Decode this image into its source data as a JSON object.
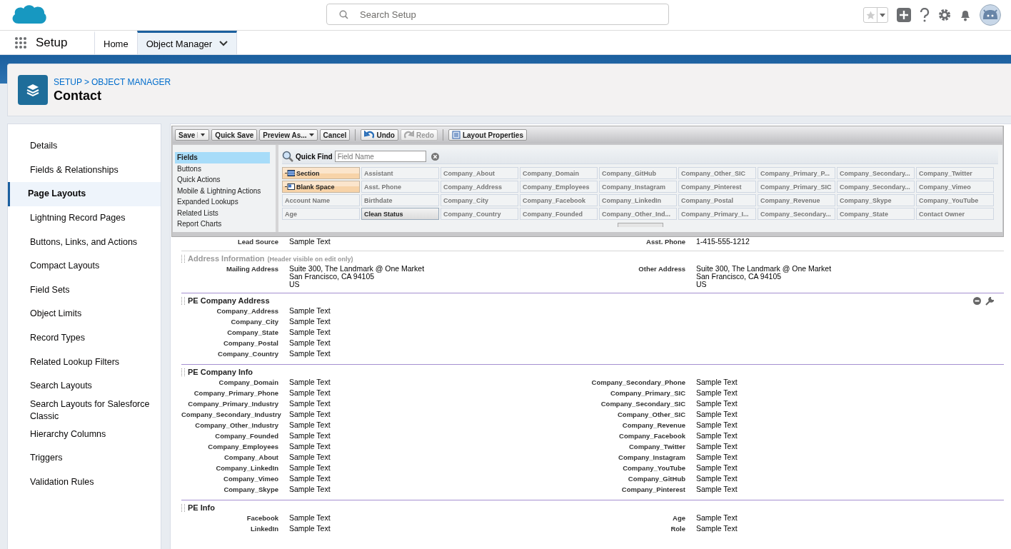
{
  "header": {
    "search": {
      "placeholder": "Search Setup"
    }
  },
  "nav": {
    "app_name": "Setup",
    "tabs": [
      {
        "label": "Home",
        "selected": false,
        "dropdown": false
      },
      {
        "label": "Object Manager",
        "selected": true,
        "dropdown": true
      }
    ]
  },
  "page_header": {
    "breadcrumb": [
      "SETUP",
      "OBJECT MANAGER"
    ],
    "separator": ">",
    "title": "Contact"
  },
  "sidebar": {
    "items": [
      {
        "label": "Details",
        "selected": false
      },
      {
        "label": "Fields & Relationships",
        "selected": false
      },
      {
        "label": "Page Layouts",
        "selected": true
      },
      {
        "label": "Lightning Record Pages",
        "selected": false
      },
      {
        "label": "Buttons, Links, and Actions",
        "selected": false
      },
      {
        "label": "Compact Layouts",
        "selected": false
      },
      {
        "label": "Field Sets",
        "selected": false
      },
      {
        "label": "Object Limits",
        "selected": false
      },
      {
        "label": "Record Types",
        "selected": false
      },
      {
        "label": "Related Lookup Filters",
        "selected": false
      },
      {
        "label": "Search Layouts",
        "selected": false
      },
      {
        "label": "Search Layouts for Salesforce Classic",
        "selected": false
      },
      {
        "label": "Hierarchy Columns",
        "selected": false
      },
      {
        "label": "Triggers",
        "selected": false
      },
      {
        "label": "Validation Rules",
        "selected": false
      }
    ]
  },
  "toolbar": {
    "groups": [
      [
        {
          "label": "Save",
          "kind": "split",
          "disabled": false
        },
        {
          "label": "Quick Save",
          "kind": "plain",
          "disabled": false
        },
        {
          "label": "Preview As...",
          "kind": "menu",
          "disabled": false
        },
        {
          "label": "Cancel",
          "kind": "plain",
          "disabled": false
        }
      ],
      [
        {
          "label": "Undo",
          "kind": "undo",
          "disabled": false
        },
        {
          "label": "Redo",
          "kind": "redo",
          "disabled": true
        }
      ],
      [
        {
          "label": "Layout Properties",
          "kind": "properties",
          "disabled": false
        }
      ]
    ]
  },
  "palette": {
    "categories": [
      {
        "label": "Fields",
        "selected": true
      },
      {
        "label": "Buttons",
        "selected": false
      },
      {
        "label": "Quick Actions",
        "selected": false
      },
      {
        "label": "Mobile & Lightning Actions",
        "selected": false
      },
      {
        "label": "Expanded Lookups",
        "selected": false
      },
      {
        "label": "Related Lists",
        "selected": false
      },
      {
        "label": "Report Charts",
        "selected": false
      }
    ],
    "quick_find": {
      "label": "Quick Find",
      "placeholder": "Field Name"
    },
    "items": [
      {
        "label": "Section",
        "kind": "section",
        "selected": false
      },
      {
        "label": "Assistant",
        "kind": "field",
        "selected": false
      },
      {
        "label": "Company_About",
        "kind": "field",
        "selected": false
      },
      {
        "label": "Company_Domain",
        "kind": "field",
        "selected": false
      },
      {
        "label": "Company_GitHub",
        "kind": "field",
        "selected": false
      },
      {
        "label": "Company_Other_SIC",
        "kind": "field",
        "selected": false
      },
      {
        "label": "Company_Primary_P...",
        "kind": "field",
        "selected": false
      },
      {
        "label": "Company_Secondary...",
        "kind": "field",
        "selected": false
      },
      {
        "label": "Company_Twitter",
        "kind": "field",
        "selected": false
      },
      {
        "label": "Blank Space",
        "kind": "blank",
        "selected": false
      },
      {
        "label": "Asst. Phone",
        "kind": "field",
        "selected": false
      },
      {
        "label": "Company_Address",
        "kind": "field",
        "selected": false
      },
      {
        "label": "Company_Employees",
        "kind": "field",
        "selected": false
      },
      {
        "label": "Company_Instagram",
        "kind": "field",
        "selected": false
      },
      {
        "label": "Company_Pinterest",
        "kind": "field",
        "selected": false
      },
      {
        "label": "Company_Primary_SIC",
        "kind": "field",
        "selected": false
      },
      {
        "label": "Company_Secondary...",
        "kind": "field",
        "selected": false
      },
      {
        "label": "Company_Vimeo",
        "kind": "field",
        "selected": false
      },
      {
        "label": "Account Name",
        "kind": "field",
        "selected": false
      },
      {
        "label": "Birthdate",
        "kind": "field",
        "selected": false
      },
      {
        "label": "Company_City",
        "kind": "field",
        "selected": false
      },
      {
        "label": "Company_Facebook",
        "kind": "field",
        "selected": false
      },
      {
        "label": "Company_LinkedIn",
        "kind": "field",
        "selected": false
      },
      {
        "label": "Company_Postal",
        "kind": "field",
        "selected": false
      },
      {
        "label": "Company_Revenue",
        "kind": "field",
        "selected": false
      },
      {
        "label": "Company_Skype",
        "kind": "field",
        "selected": false
      },
      {
        "label": "Company_YouTube",
        "kind": "field",
        "selected": false
      },
      {
        "label": "Age",
        "kind": "field",
        "selected": false
      },
      {
        "label": "Clean Status",
        "kind": "field",
        "selected": true
      },
      {
        "label": "Company_Country",
        "kind": "field",
        "selected": false
      },
      {
        "label": "Company_Founded",
        "kind": "field",
        "selected": false
      },
      {
        "label": "Company_Other_Ind...",
        "kind": "field",
        "selected": false
      },
      {
        "label": "Company_Primary_I...",
        "kind": "field",
        "selected": false
      },
      {
        "label": "Company_Secondary...",
        "kind": "field",
        "selected": false
      },
      {
        "label": "Company_State",
        "kind": "field",
        "selected": false
      },
      {
        "label": "Contact Owner",
        "kind": "field",
        "selected": false
      }
    ]
  },
  "layout": {
    "sections": [
      {
        "header_hidden": false,
        "tools": false,
        "rows": [
          {
            "left": {
              "label": "Lead Source",
              "value": [
                "Sample Text"
              ]
            },
            "right": {
              "label": "Asst. Phone",
              "value": [
                "1-415-555-1212"
              ]
            }
          }
        ]
      },
      {
        "title": "Address Information",
        "note": "(Header visible on edit only)",
        "header_hidden": true,
        "tools": false,
        "rows": [
          {
            "left": {
              "label": "Mailing Address",
              "value": [
                "Suite 300, The Landmark @ One Market",
                "San Francisco, CA 94105",
                "US"
              ]
            },
            "right": {
              "label": "Other Address",
              "value": [
                "Suite 300, The Landmark @ One Market",
                "San Francisco, CA 94105",
                "US"
              ]
            }
          }
        ]
      },
      {
        "title": "PE Company Address",
        "header_hidden": false,
        "tools": true,
        "rows": [
          {
            "left": {
              "label": "Company_Address",
              "value": [
                "Sample Text"
              ]
            }
          },
          {
            "left": {
              "label": "Company_City",
              "value": [
                "Sample Text"
              ]
            }
          },
          {
            "left": {
              "label": "Company_State",
              "value": [
                "Sample Text"
              ]
            }
          },
          {
            "left": {
              "label": "Company_Postal",
              "value": [
                "Sample Text"
              ]
            }
          },
          {
            "left": {
              "label": "Company_Country",
              "value": [
                "Sample Text"
              ]
            }
          }
        ]
      },
      {
        "title": "PE Company Info",
        "header_hidden": false,
        "tools": false,
        "rows": [
          {
            "left": {
              "label": "Company_Domain",
              "value": [
                "Sample Text"
              ]
            },
            "right": {
              "label": "Company_Secondary_Phone",
              "value": [
                "Sample Text"
              ]
            }
          },
          {
            "left": {
              "label": "Company_Primary_Phone",
              "value": [
                "Sample Text"
              ]
            },
            "right": {
              "label": "Company_Primary_SIC",
              "value": [
                "Sample Text"
              ]
            }
          },
          {
            "left": {
              "label": "Company_Primary_Industry",
              "value": [
                "Sample Text"
              ]
            },
            "right": {
              "label": "Company_Secondary_SIC",
              "value": [
                "Sample Text"
              ]
            }
          },
          {
            "left": {
              "label": "Company_Secondary_Industry",
              "value": [
                "Sample Text"
              ]
            },
            "right": {
              "label": "Company_Other_SIC",
              "value": [
                "Sample Text"
              ]
            }
          },
          {
            "left": {
              "label": "Company_Other_Industry",
              "value": [
                "Sample Text"
              ]
            },
            "right": {
              "label": "Company_Revenue",
              "value": [
                "Sample Text"
              ]
            }
          },
          {
            "left": {
              "label": "Company_Founded",
              "value": [
                "Sample Text"
              ]
            },
            "right": {
              "label": "Company_Facebook",
              "value": [
                "Sample Text"
              ]
            }
          },
          {
            "left": {
              "label": "Company_Employees",
              "value": [
                "Sample Text"
              ]
            },
            "right": {
              "label": "Company_Twitter",
              "value": [
                "Sample Text"
              ]
            }
          },
          {
            "left": {
              "label": "Company_About",
              "value": [
                "Sample Text"
              ]
            },
            "right": {
              "label": "Company_Instagram",
              "value": [
                "Sample Text"
              ]
            }
          },
          {
            "left": {
              "label": "Company_LinkedIn",
              "value": [
                "Sample Text"
              ]
            },
            "right": {
              "label": "Company_YouTube",
              "value": [
                "Sample Text"
              ]
            }
          },
          {
            "left": {
              "label": "Company_Vimeo",
              "value": [
                "Sample Text"
              ]
            },
            "right": {
              "label": "Company_GitHub",
              "value": [
                "Sample Text"
              ]
            }
          },
          {
            "left": {
              "label": "Company_Skype",
              "value": [
                "Sample Text"
              ]
            },
            "right": {
              "label": "Company_Pinterest",
              "value": [
                "Sample Text"
              ]
            }
          }
        ]
      },
      {
        "title": "PE Info",
        "header_hidden": false,
        "tools": false,
        "rows": [
          {
            "left": {
              "label": "Facebook",
              "value": [
                "Sample Text"
              ]
            },
            "right": {
              "label": "Age",
              "value": [
                "Sample Text"
              ]
            }
          },
          {
            "left": {
              "label": "LinkedIn",
              "value": [
                "Sample Text"
              ]
            },
            "right": {
              "label": "Role",
              "value": [
                "Sample Text"
              ]
            }
          }
        ]
      }
    ]
  }
}
